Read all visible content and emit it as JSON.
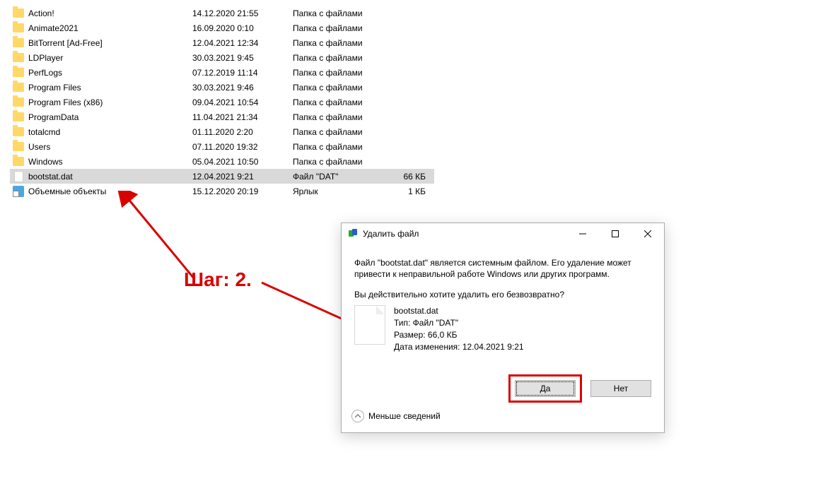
{
  "files": [
    {
      "name": "Action!",
      "date": "14.12.2020 21:55",
      "type": "Папка с файлами",
      "size": "",
      "icon": "folder"
    },
    {
      "name": "Animate2021",
      "date": "16.09.2020 0:10",
      "type": "Папка с файлами",
      "size": "",
      "icon": "folder"
    },
    {
      "name": "BitTorrent [Ad-Free]",
      "date": "12.04.2021 12:34",
      "type": "Папка с файлами",
      "size": "",
      "icon": "folder"
    },
    {
      "name": "LDPlayer",
      "date": "30.03.2021 9:45",
      "type": "Папка с файлами",
      "size": "",
      "icon": "folder"
    },
    {
      "name": "PerfLogs",
      "date": "07.12.2019 11:14",
      "type": "Папка с файлами",
      "size": "",
      "icon": "folder"
    },
    {
      "name": "Program Files",
      "date": "30.03.2021 9:46",
      "type": "Папка с файлами",
      "size": "",
      "icon": "folder"
    },
    {
      "name": "Program Files (x86)",
      "date": "09.04.2021 10:54",
      "type": "Папка с файлами",
      "size": "",
      "icon": "folder"
    },
    {
      "name": "ProgramData",
      "date": "11.04.2021 21:34",
      "type": "Папка с файлами",
      "size": "",
      "icon": "folder"
    },
    {
      "name": "totalcmd",
      "date": "01.11.2020 2:20",
      "type": "Папка с файлами",
      "size": "",
      "icon": "folder"
    },
    {
      "name": "Users",
      "date": "07.11.2020 19:32",
      "type": "Папка с файлами",
      "size": "",
      "icon": "folder"
    },
    {
      "name": "Windows",
      "date": "05.04.2021 10:50",
      "type": "Папка с файлами",
      "size": "",
      "icon": "folder"
    },
    {
      "name": "bootstat.dat",
      "date": "12.04.2021 9:21",
      "type": "Файл \"DAT\"",
      "size": "66 КБ",
      "icon": "file",
      "selected": true
    },
    {
      "name": "Объемные объекты",
      "date": "15.12.2020 20:19",
      "type": "Ярлык",
      "size": "1 КБ",
      "icon": "shortcut"
    }
  ],
  "annotation": "Шаг: 2.",
  "dialog": {
    "title": "Удалить файл",
    "warning_line1": "Файл \"bootstat.dat\" является системным файлом. Его удаление может",
    "warning_line2": "привести к неправильной работе Windows или других программ.",
    "confirm": "Вы действительно хотите удалить его безвозвратно?",
    "file_name": "bootstat.dat",
    "file_type": "Тип: Файл \"DAT\"",
    "file_size": "Размер: 66,0 КБ",
    "file_date": "Дата изменения: 12.04.2021 9:21",
    "yes": "Да",
    "no": "Нет",
    "less_info": "Меньше сведений"
  }
}
